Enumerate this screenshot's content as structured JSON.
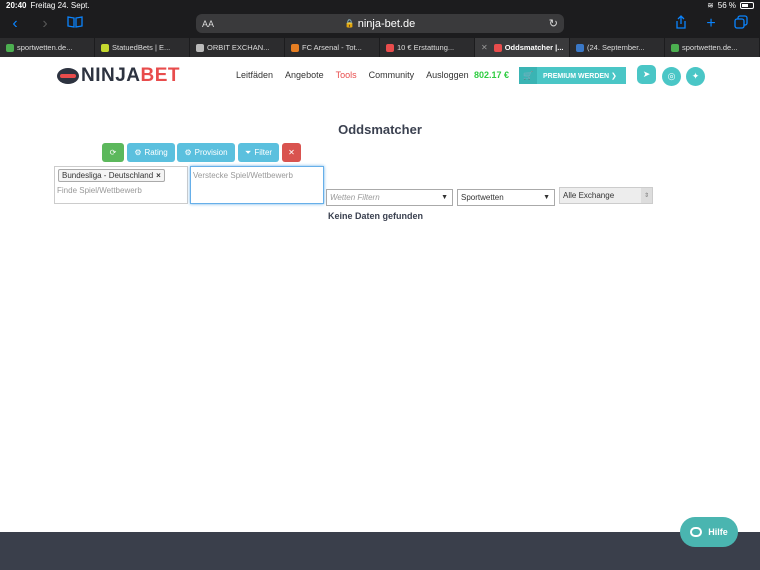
{
  "status_bar": {
    "time": "20:40",
    "date": "Freitag 24. Sept.",
    "battery": "56 %"
  },
  "browser": {
    "url": "ninja-bet.de",
    "aa_label": "AA",
    "tabs": [
      {
        "label": "sportwetten.de...",
        "color": "#4caf50",
        "active": false
      },
      {
        "label": "StatuedBets | E...",
        "color": "#c5d92f",
        "active": false
      },
      {
        "label": "ORBIT EXCHAN...",
        "color": "#bbbbbb",
        "active": false
      },
      {
        "label": "FC Arsenal - Tot...",
        "color": "#e67e22",
        "active": false
      },
      {
        "label": "10 € Erstattung...",
        "color": "#e84c4c",
        "active": false
      },
      {
        "label": "Oddsmatcher |...",
        "color": "#e84c4c",
        "active": true
      },
      {
        "label": "(24. September...",
        "color": "#3a78c7",
        "active": false
      },
      {
        "label": "sportwetten.de...",
        "color": "#4caf50",
        "active": false
      }
    ]
  },
  "site": {
    "logo_part1": "NINJA",
    "logo_part2": "BET",
    "nav": [
      "Leitfäden",
      "Angebote",
      "Tools",
      "Community",
      "Ausloggen"
    ],
    "nav_active": "Tools",
    "balance": "802.17 €",
    "premium_label": "PREMIUM WERDEN ❯",
    "colors": {
      "accent": "#4ac6c6",
      "brand_red": "#e84c4c",
      "balance_green": "#2ecc40"
    }
  },
  "main": {
    "title": "Oddsmatcher",
    "buttons": {
      "rating": "Rating",
      "provision": "Provision",
      "filter": "Filter"
    },
    "selected_tag": "Bundesliga - Deutschland",
    "find_placeholder": "Finde Spiel/Wettbewerb",
    "hide_placeholder": "Verstecke Spiel/Wettbewerb",
    "bet_filter_placeholder": "Wetten Filtern",
    "sport_select": "Sportwetten",
    "exchange_select": "Alle Exchange",
    "empty_message": "Keine Daten gefunden"
  },
  "help_label": "Hilfe"
}
